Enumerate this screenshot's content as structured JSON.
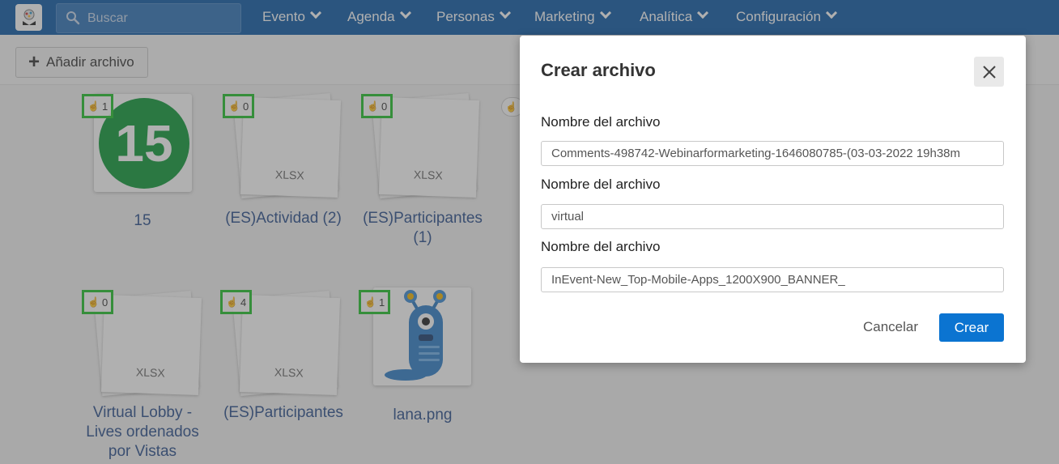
{
  "header": {
    "search": {
      "placeholder": "Buscar"
    },
    "nav": [
      {
        "label": "Evento"
      },
      {
        "label": "Agenda"
      },
      {
        "label": "Personas"
      },
      {
        "label": "Marketing"
      },
      {
        "label": "Analítica"
      },
      {
        "label": "Configuración"
      }
    ],
    "brand_color": "#0d5aa6"
  },
  "toolbar": {
    "add_file_label": "Añadir archivo"
  },
  "files": [
    {
      "name": "15",
      "clicks": "1",
      "thumb_text": "15",
      "type": "image"
    },
    {
      "name": "(ES)Actividad (2)",
      "clicks": "0",
      "thumb_text": "XLSX",
      "type": "document"
    },
    {
      "name": "(ES)Participantes (1)",
      "clicks": "0",
      "thumb_text": "XLSX",
      "type": "document"
    },
    {
      "name": "Virtual Lobby - Lives ordenados por Vistas",
      "clicks": "0",
      "thumb_text": "XLSX",
      "type": "document"
    },
    {
      "name": "(ES)Participantes",
      "clicks": "4",
      "thumb_text": "XLSX",
      "type": "document"
    },
    {
      "name": "lana.png",
      "clicks": "1",
      "type": "image"
    }
  ],
  "modal": {
    "title": "Crear archivo",
    "fields": [
      {
        "label": "Nombre del archivo",
        "value": "Comments-498742-Webinarformarketing-1646080785-(03-03-2022 19h38m"
      },
      {
        "label": "Nombre del archivo",
        "value": "virtual"
      },
      {
        "label": "Nombre del archivo",
        "value": "InEvent-New_Top-Mobile-Apps_1200X900_BANNER_"
      }
    ],
    "cancel_label": "Cancelar",
    "create_label": "Crear"
  },
  "colors": {
    "primary": "#0b74d1",
    "badge_border": "#22c22b",
    "link_text": "#2b4f8c"
  }
}
